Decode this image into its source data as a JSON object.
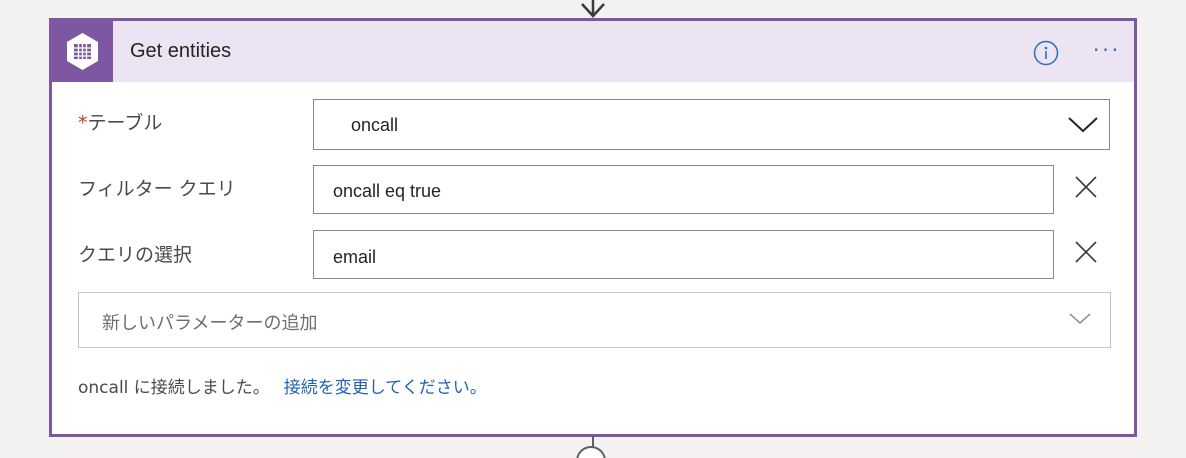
{
  "action": {
    "title": "Get entities",
    "info_icon": "info-icon",
    "more_icon": "more-options-icon",
    "more_label": "···",
    "header_color": "#ece4f2",
    "accent_color": "#7e57a3"
  },
  "fields": {
    "table": {
      "required_mark": "*",
      "label": "テーブル",
      "value": "oncall"
    },
    "filter": {
      "label": "フィルター クエリ",
      "value": "oncall eq true"
    },
    "select": {
      "label": "クエリの選択",
      "value": "email"
    }
  },
  "add_parameter": {
    "label": "新しいパラメーターの追加"
  },
  "connection": {
    "status": "oncall に接続しました。",
    "change_link": "接続を変更してください。",
    "link_color": "#1f62b3"
  }
}
